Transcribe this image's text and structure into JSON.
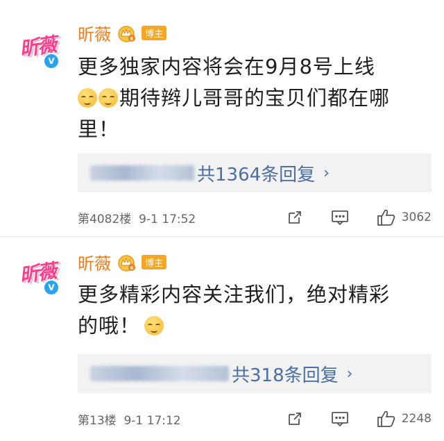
{
  "comments": [
    {
      "avatar_text": "昕薇",
      "name": "昕薇",
      "role_badge": "博主",
      "content_line1": "更多独家内容将会在9月8号上线",
      "content_line2": "期待辫儿哥哥的宝贝们都在哪",
      "content_line3": "里！",
      "reply_summary": "共1364条回复",
      "floor": "第4082楼",
      "time": "9-1 17:52",
      "likes": "3062"
    },
    {
      "avatar_text": "昕薇",
      "name": "昕薇",
      "role_badge": "博主",
      "content_line1": "更多精彩内容关注我们，绝对精彩",
      "content_line2": "的哦！",
      "reply_summary": "共318条回复",
      "floor": "第13楼",
      "time": "9-1 17:12",
      "likes": "2248"
    }
  ],
  "icons": {
    "verified": "verified-v-icon",
    "crown": "crown-icon",
    "emoji": "smile-emoji-icon",
    "share": "share-icon",
    "comment": "comment-icon",
    "like": "thumbs-up-icon"
  },
  "colors": {
    "name": "#f07d1e",
    "link": "#4a6fa5",
    "verified": "#2aa3ef",
    "badge": "#f5a623"
  }
}
